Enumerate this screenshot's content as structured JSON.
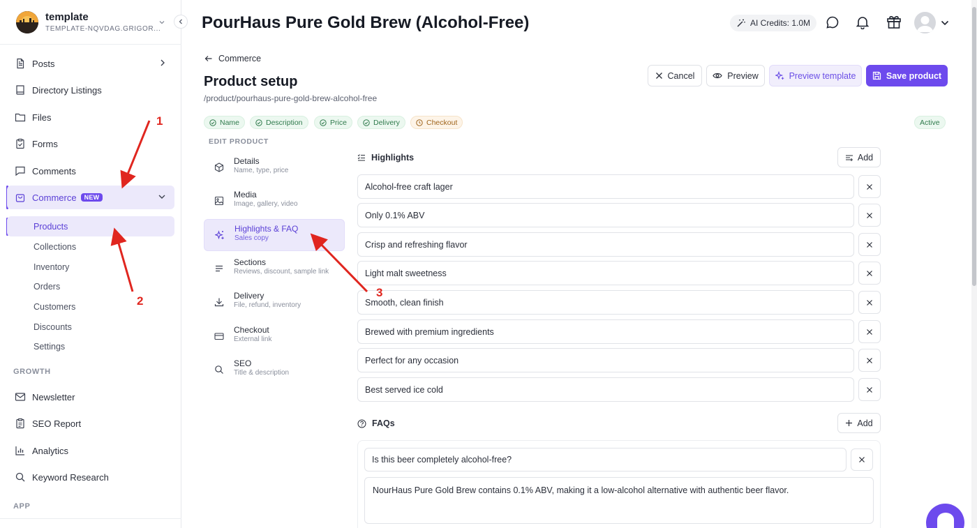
{
  "workspace": {
    "name": "template",
    "subtitle": "TEMPLATE-NQVDAG.GRIGOR..."
  },
  "sidebar": {
    "items": [
      {
        "label": "Posts",
        "icon": "file-text-icon"
      },
      {
        "label": "Directory Listings",
        "icon": "book-icon"
      },
      {
        "label": "Files",
        "icon": "folder-icon"
      },
      {
        "label": "Forms",
        "icon": "clipboard-icon"
      },
      {
        "label": "Comments",
        "icon": "message-square-icon"
      },
      {
        "label": "Commerce",
        "icon": "shopping-bag-icon",
        "badge": "NEW"
      }
    ],
    "commerce_sub": [
      "Products",
      "Collections",
      "Inventory",
      "Orders",
      "Customers",
      "Discounts",
      "Settings"
    ],
    "growth_label": "GROWTH",
    "growth_items": [
      {
        "label": "Newsletter",
        "icon": "mail-icon"
      },
      {
        "label": "SEO Report",
        "icon": "clipboard-list-icon"
      },
      {
        "label": "Analytics",
        "icon": "bar-chart-icon"
      },
      {
        "label": "Keyword Research",
        "icon": "search-icon"
      }
    ],
    "app_label": "APP"
  },
  "header": {
    "title": "PourHaus Pure Gold Brew (Alcohol-Free)",
    "credits": "AI Credits: 1.0M"
  },
  "main": {
    "back_label": "Commerce",
    "setup_title": "Product setup",
    "path": "/product/pourhaus-pure-gold-brew-alcohol-free",
    "buttons": {
      "cancel": "Cancel",
      "preview": "Preview",
      "preview_template": "Preview template",
      "save": "Save product"
    },
    "status_pills": [
      {
        "label": "Name",
        "state": "done"
      },
      {
        "label": "Description",
        "state": "done"
      },
      {
        "label": "Price",
        "state": "done"
      },
      {
        "label": "Delivery",
        "state": "done"
      },
      {
        "label": "Checkout",
        "state": "pending"
      }
    ],
    "status": "Active",
    "edit_label": "EDIT PRODUCT",
    "steps": [
      {
        "title": "Details",
        "sub": "Name, type, price",
        "icon": "box-icon"
      },
      {
        "title": "Media",
        "sub": "Image, gallery, video",
        "icon": "image-icon"
      },
      {
        "title": "Highlights & FAQ",
        "sub": "Sales copy",
        "icon": "sparkles-icon"
      },
      {
        "title": "Sections",
        "sub": "Reviews, discount, sample link",
        "icon": "list-icon"
      },
      {
        "title": "Delivery",
        "sub": "File, refund, inventory",
        "icon": "download-icon"
      },
      {
        "title": "Checkout",
        "sub": "External link",
        "icon": "credit-card-icon"
      },
      {
        "title": "SEO",
        "sub": "Title & description",
        "icon": "search-icon"
      }
    ],
    "highlights_label": "Highlights",
    "add_label": "Add",
    "highlights": [
      "Alcohol-free craft lager",
      "Only 0.1% ABV",
      "Crisp and refreshing flavor",
      "Light malt sweetness",
      "Smooth, clean finish",
      "Brewed with premium ingredients",
      "Perfect for any occasion",
      "Best served ice cold"
    ],
    "faqs_label": "FAQs",
    "faq": {
      "question": "Is this beer completely alcohol-free?",
      "answer": "NourHaus Pure Gold Brew contains 0.1% ABV, making it a low-alcohol alternative with authentic beer flavor."
    }
  },
  "annotations": [
    "1",
    "2",
    "3"
  ],
  "colors": {
    "accent": "#6d4aed",
    "arrow": "#e0261f",
    "success": "#2f7a4c",
    "warning": "#a0651d"
  }
}
